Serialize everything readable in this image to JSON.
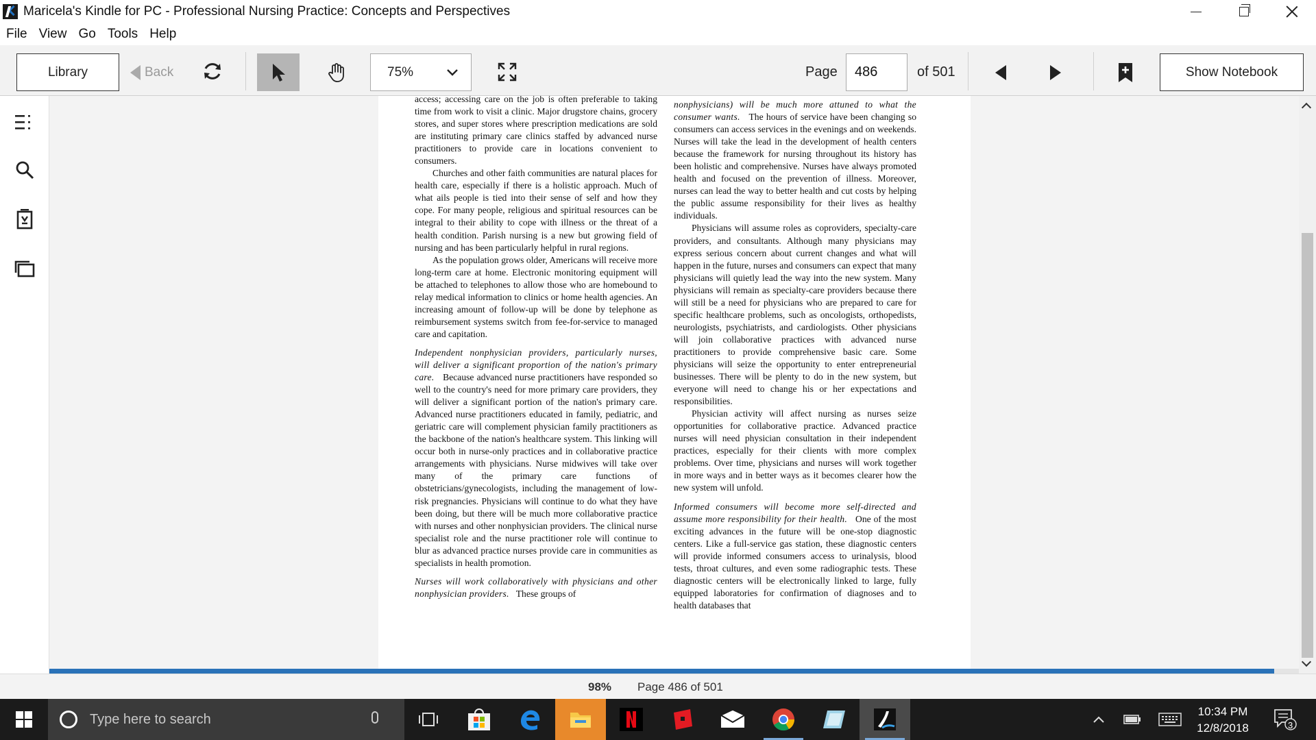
{
  "window": {
    "title": "Maricela's Kindle for PC - Professional Nursing Practice: Concepts and Perspectives"
  },
  "menu": [
    "File",
    "View",
    "Go",
    "Tools",
    "Help"
  ],
  "toolbar": {
    "library_label": "Library",
    "back_label": "Back",
    "zoom_value": "75%",
    "page_label": "Page",
    "page_value": "486",
    "page_of": "of 501",
    "notebook_label": "Show Notebook"
  },
  "book": {
    "left_column": [
      {
        "text": "access; accessing care on the job is often preferable to taking time from work to visit a clinic. Major drugstore chains, grocery stores, and super stores where prescription medications are sold are instituting primary care clinics staffed by advanced nurse practitioners to provide care in locations convenient to consumers."
      },
      {
        "text": "Churches and other faith communities are natural places for health care, especially if there is a holistic approach. Much of what ails people is tied into their sense of self and how they cope. For many people, religious and spiritual resources can be integral to their ability to cope with illness or the threat of a health condition. Parish nursing is a new but growing field of nursing and has been particularly helpful in rural regions."
      },
      {
        "text": "As the population grows older, Americans will receive more long-term care at home. Electronic monitoring equipment will be attached to telephones to allow those who are homebound to relay medical information to clinics or home health agencies. An increasing amount of follow-up will be done by telephone as reimbursement systems switch from fee-for-service to managed care and capitation."
      },
      {
        "heading": "Independent nonphysician providers, particularly nurses, will deliver a significant proportion of the nation's primary care.",
        "text": "Because advanced nurse practitioners have responded so well to the country's need for more primary care providers, they will deliver a significant portion of the nation's primary care. Advanced nurse practitioners educated in family, pediatric, and geriatric care will complement physician family practitioners as the backbone of the nation's healthcare system. This linking will occur both in nurse-only practices and in collaborative practice arrangements with physicians. Nurse midwives will take over many of the primary care functions of obstetricians/gynecologists, including the management of low-risk pregnancies. Physicians will continue to do what they have been doing, but there will be much more collaborative practice with nurses and other nonphysician providers. The clinical nurse specialist role and the nurse practitioner role will continue to blur as advanced practice nurses provide care in communities as specialists in health promotion."
      },
      {
        "heading": "Nurses will work collaboratively with physicians and other nonphysician providers.",
        "text": "These groups of"
      }
    ],
    "right_column": [
      {
        "heading": "nonphysicians) will be much more attuned to what the consumer wants.",
        "text": "The hours of service have been changing so consumers can access services in the evenings and on weekends. Nurses will take the lead in the development of health centers because the framework for nursing throughout its history has been holistic and comprehensive. Nurses have always promoted health and focused on the prevention of illness. Moreover, nurses can lead the way to better health and cut costs by helping the public assume responsibility for their lives as healthy individuals."
      },
      {
        "text": "Physicians will assume roles as coproviders, specialty-care providers, and consultants. Although many physicians may express serious concern about current changes and what will happen in the future, nurses and consumers can expect that many physicians will quietly lead the way into the new system. Many physicians will remain as specialty-care providers because there will still be a need for physicians who are prepared to care for specific healthcare problems, such as oncologists, orthopedists, neurologists, psychiatrists, and cardiologists. Other physicians will join collaborative practices with advanced nurse practitioners to provide comprehensive basic care. Some physicians will seize the opportunity to enter entrepreneurial businesses. There will be plenty to do in the new system, but everyone will need to change his or her expectations and responsibilities."
      },
      {
        "text": "Physician activity will affect nursing as nurses seize opportunities for collaborative practice. Advanced practice nurses will need physician consultation in their independent practices, especially for their clients with more complex problems. Over time, physicians and nurses will work together in more ways and in better ways as it becomes clearer how the new system will unfold."
      },
      {
        "heading": "Informed consumers will become more self-directed and assume more responsibility for their health.",
        "text": "One of the most exciting advances in the future will be one-stop diagnostic centers. Like a full-service gas station, these diagnostic centers will provide informed consumers access to urinalysis, blood tests, throat cultures, and even some radiographic tests. These diagnostic centers will be electronically linked to large, fully equipped laboratories for confirmation of diagnoses and to health databases that"
      }
    ]
  },
  "status": {
    "percent": "98%",
    "percent_value": 98,
    "page_text": "Page 486 of 501"
  },
  "taskbar": {
    "search_placeholder": "Type here to search",
    "time": "10:34 PM",
    "date": "12/8/2018",
    "notification_count": "3"
  },
  "colors": {
    "progress": "#2a72b8",
    "taskbar": "#1b1b1b",
    "toolbar": "#f2f2f2"
  }
}
